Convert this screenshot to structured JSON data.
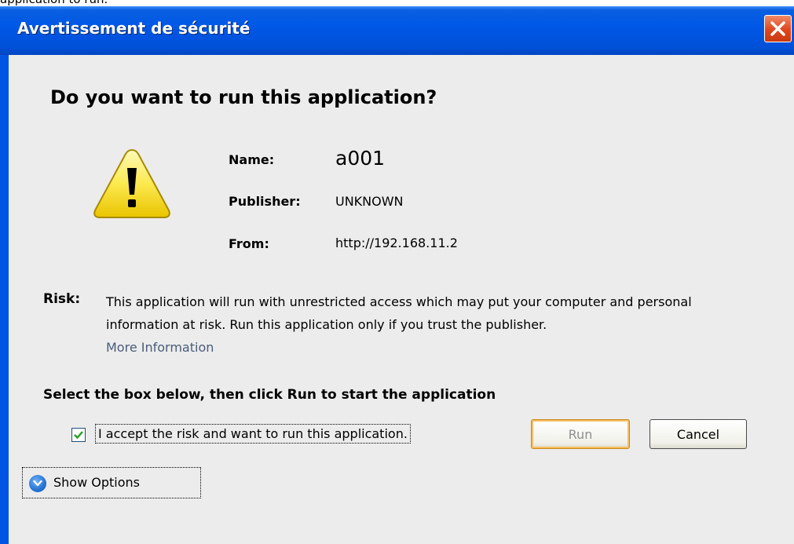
{
  "top_strip": {
    "text": "application to run."
  },
  "window": {
    "title": "Avertissement de sécurité",
    "close_icon": "close-icon"
  },
  "dialog": {
    "heading": "Do you want to run this application?",
    "warning_icon": "warning-triangle-icon",
    "fields": {
      "name_label": "Name:",
      "name_value": "a001",
      "publisher_label": "Publisher:",
      "publisher_value": "UNKNOWN",
      "from_label": "From:",
      "from_value": "http://192.168.11.2"
    },
    "risk": {
      "label": "Risk:",
      "text": "This application will run with unrestricted access which may put your computer and personal information at risk. Run this application only if you trust the publisher.",
      "more_info": "More Information"
    },
    "instruction": "Select the box below, then click Run to start the application",
    "accept": {
      "checked": true,
      "label": "I accept the risk and want to run this application."
    },
    "buttons": {
      "run": "Run",
      "cancel": "Cancel"
    },
    "show_options": {
      "label": "Show Options",
      "icon": "chevron-down-circle-icon"
    }
  },
  "colors": {
    "title_bar": "#0054e3",
    "dialog_background": "#ececec",
    "close_button": "#e0461c",
    "warning_fill": "#fce94f",
    "link": "#4a5d7a"
  }
}
